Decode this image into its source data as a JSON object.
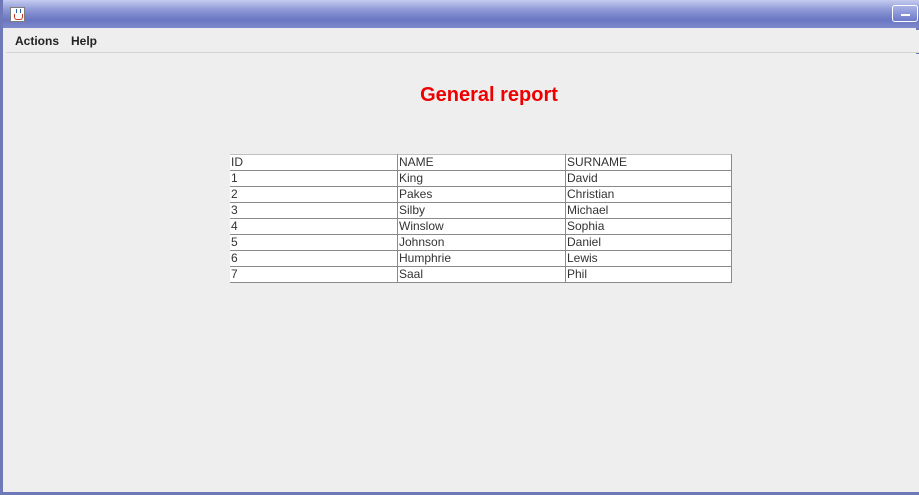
{
  "window": {
    "title": "",
    "icon": "java-cup-icon",
    "controls": [
      "minimize-icon"
    ],
    "colors": {
      "frame": "#6f78b8",
      "background": "#eeeeee"
    }
  },
  "menubar": {
    "items": [
      {
        "label": "Actions"
      },
      {
        "label": "Help"
      }
    ]
  },
  "report": {
    "title": "General report",
    "title_color": "#ee0000",
    "headers": [
      "ID",
      "NAME",
      "SURNAME"
    ],
    "rows": [
      [
        "1",
        "King",
        "David"
      ],
      [
        "2",
        "Pakes",
        "Christian"
      ],
      [
        "3",
        "Silby",
        "Michael"
      ],
      [
        "4",
        "Winslow",
        "Sophia"
      ],
      [
        "5",
        "Johnson",
        "Daniel"
      ],
      [
        "6",
        "Humphrie",
        "Lewis"
      ],
      [
        "7",
        "Saal",
        "Phil"
      ]
    ]
  }
}
